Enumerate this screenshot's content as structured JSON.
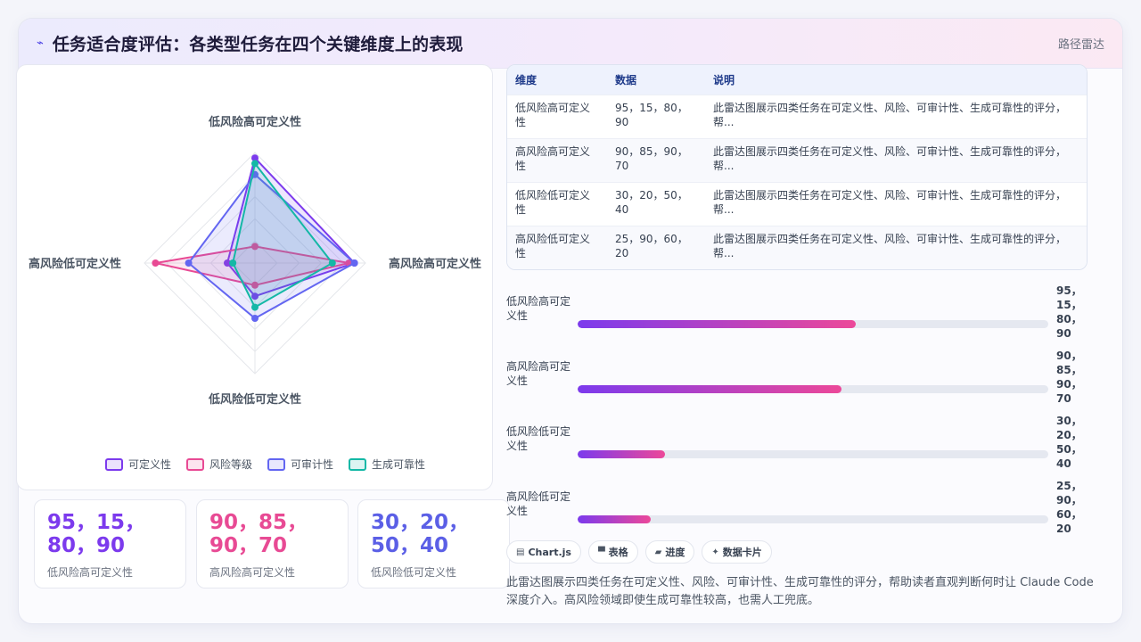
{
  "header": {
    "icon": "trend-icon",
    "title": "任务适合度评估：各类型任务在四个关键维度上的表现",
    "badge": "路径雷达"
  },
  "chart_data": {
    "type": "radar",
    "axes": [
      "低风险高可定义性",
      "高风险高可定义性",
      "低风险低可定义性",
      "高风险低可定义性"
    ],
    "rmax": 100,
    "series": [
      {
        "name": "可定义性",
        "values": [
          95,
          90,
          30,
          25
        ],
        "color": "#7c3aed"
      },
      {
        "name": "风险等级",
        "values": [
          15,
          85,
          20,
          90
        ],
        "color": "#e84a94"
      },
      {
        "name": "可审计性",
        "values": [
          80,
          90,
          50,
          60
        ],
        "color": "#6366f1"
      },
      {
        "name": "生成可靠性",
        "values": [
          90,
          70,
          40,
          20
        ],
        "color": "#14b8a6"
      }
    ]
  },
  "stats": [
    {
      "value": "95，15，80，90",
      "label": "低风险高可定义性",
      "color": "#7c3aed"
    },
    {
      "value": "90，85，90，70",
      "label": "高风险高可定义性",
      "color": "#e84a94"
    },
    {
      "value": "30，20，50，40",
      "label": "低风险低可定义性",
      "color": "#5b5fe6"
    }
  ],
  "table": {
    "headers": [
      "维度",
      "数据",
      "说明"
    ],
    "rows": [
      [
        "低风险高可定义性",
        "95，15，80，90",
        "此雷达图展示四类任务在可定义性、风险、可审计性、生成可靠性的评分，帮..."
      ],
      [
        "高风险高可定义性",
        "90，85，90，70",
        "此雷达图展示四类任务在可定义性、风险、可审计性、生成可靠性的评分，帮..."
      ],
      [
        "低风险低可定义性",
        "30，20，50，40",
        "此雷达图展示四类任务在可定义性、风险、可审计性、生成可靠性的评分，帮..."
      ],
      [
        "高风险低可定义性",
        "25，90，60，20",
        "此雷达图展示四类任务在可定义性、风险、可审计性、生成可靠性的评分，帮..."
      ]
    ]
  },
  "progress": [
    {
      "label": "低风险高可定义性",
      "value": "95，15，80，90",
      "fraction": 0.59
    },
    {
      "label": "高风险高可定义性",
      "value": "90，85，90，70",
      "fraction": 0.56
    },
    {
      "label": "低风险低可定义性",
      "value": "30，20，50，40",
      "fraction": 0.185
    },
    {
      "label": "高风险低可定义性",
      "value": "25，90，60，20",
      "fraction": 0.155
    }
  ],
  "chips": [
    {
      "icon": "chart-icon",
      "glyph": "▤",
      "label": "Chart.js"
    },
    {
      "icon": "table-icon",
      "glyph": "▀",
      "label": "表格"
    },
    {
      "icon": "progress-icon",
      "glyph": "▰",
      "label": "进度"
    },
    {
      "icon": "sparkle-icon",
      "glyph": "✦",
      "label": "数据卡片"
    }
  ],
  "description": "此雷达图展示四类任务在可定义性、风险、可审计性、生成可靠性的评分，帮助读者直观判断何时让 Claude Code 深度介入。高风险领域即使生成可靠性较高，也需人工兜底。"
}
